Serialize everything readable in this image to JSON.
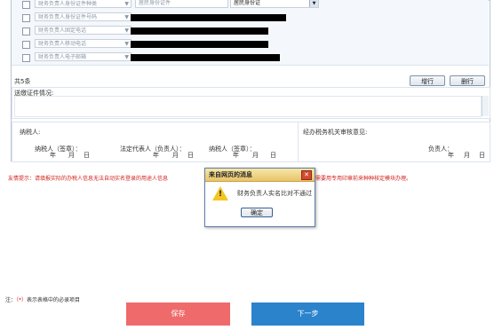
{
  "rows": [
    {
      "label": "财务负责人身份证件种类",
      "value": "居民身份证件",
      "has_select": true,
      "select_text": "居民身份证"
    },
    {
      "label": "财务负责人身份证件号码"
    },
    {
      "label": "财务负责人固定电话"
    },
    {
      "label": "财务负责人移动电话"
    },
    {
      "label": "财务负责人电子邮箱"
    }
  ],
  "table_footer": {
    "count_text": "共5条",
    "add_row": "增行",
    "delete_row": "删行"
  },
  "notes": {
    "label": "送缴证件情况:"
  },
  "signatures": {
    "taxpayer_header": "纳税人:",
    "tax_office_header": "经办税务机关审核意见:",
    "taxpayer_sign": "纳税人（签章）：",
    "legal_rep_sign": "法定代表人（负责人）：",
    "taxpayer_sign2": "纳税人（签章）：",
    "responsible": "负责人：",
    "year": "年",
    "month": "月",
    "day": "日"
  },
  "warning": {
    "left": "友情提示：请填报实际的办税人信息无法自动实名登录的用途人信息",
    "right": "需要用专用印章前来种种核定模块办理。"
  },
  "dialog": {
    "title": "来自网页的消息",
    "close": "✕",
    "message": "财务负责人实名比对不通过",
    "ok": "确定"
  },
  "footnote": {
    "prefix": "注：",
    "marker": "（*）",
    "text": "表示表格中的必录项目"
  },
  "actions": {
    "save": "保存",
    "next": "下一步"
  },
  "colors": {
    "save_bg": "#ef6b6b",
    "next_bg": "#2b83cc",
    "dialog_title": "#e9c46a"
  }
}
